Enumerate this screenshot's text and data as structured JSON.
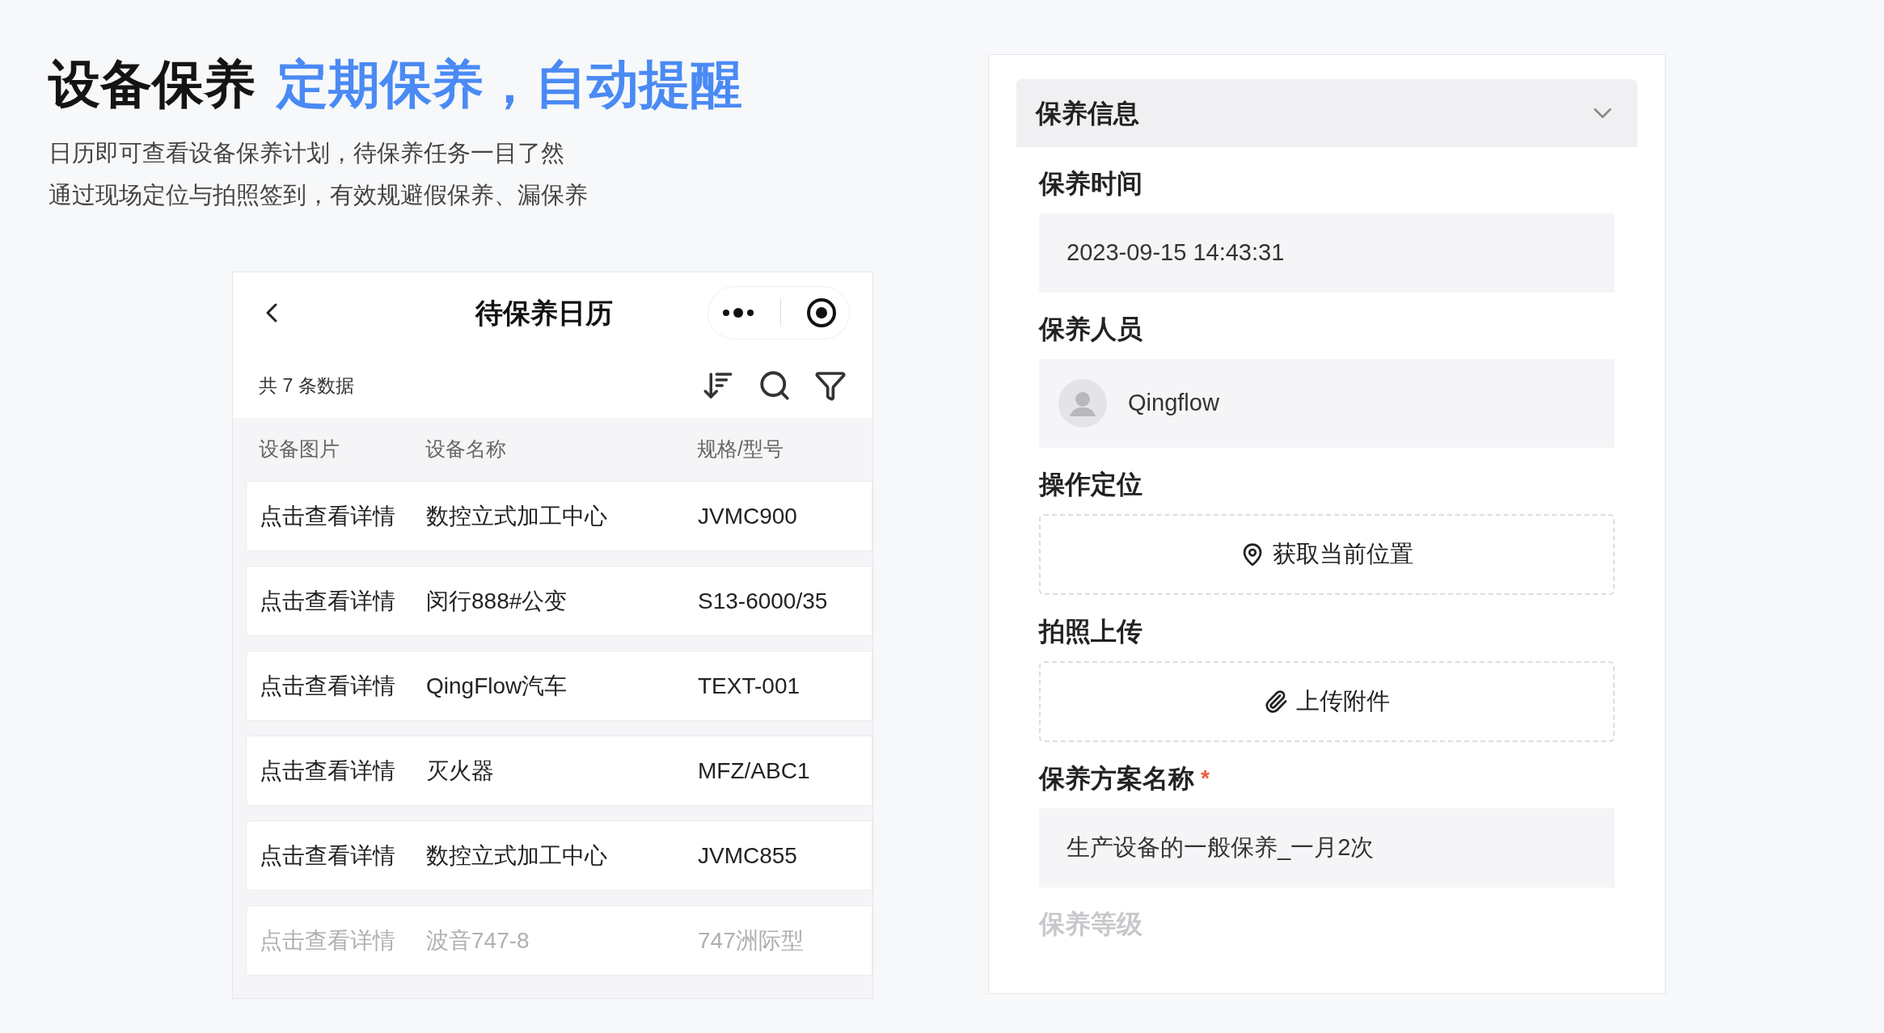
{
  "headline": {
    "main": "设备保养",
    "accent": "定期保养，自动提醒"
  },
  "description": [
    "日历即可查看设备保养计划，待保养任务一目了然",
    "通过现场定位与拍照签到，有效规避假保养、漏保养"
  ],
  "phone": {
    "title": "待保养日历",
    "count": "共 7 条数据",
    "columns": [
      "设备图片",
      "设备名称",
      "规格/型号"
    ],
    "rows": [
      {
        "cells": [
          "点击查看详情",
          "数控立式加工中心",
          "JVMC900"
        ]
      },
      {
        "cells": [
          "点击查看详情",
          "闵行888#公变",
          "S13-6000/35"
        ]
      },
      {
        "cells": [
          "点击查看详情",
          "QingFlow汽车",
          "TEXT-001"
        ]
      },
      {
        "cells": [
          "点击查看详情",
          "灭火器",
          "MFZ/ABC1"
        ]
      },
      {
        "cells": [
          "点击查看详情",
          "数控立式加工中心",
          "JVMC855"
        ]
      },
      {
        "cells": [
          "点击查看详情",
          "波音747-8",
          "747洲际型"
        ]
      }
    ]
  },
  "form": {
    "section": "保养信息",
    "expanded": true,
    "fields": [
      {
        "kind": "text",
        "label": "保养时间",
        "value": "2023-09-15 14:43:31"
      },
      {
        "kind": "user",
        "label": "保养人员",
        "value": "Qingflow"
      },
      {
        "kind": "location",
        "label": "操作定位",
        "value": "获取当前位置"
      },
      {
        "kind": "upload",
        "label": "拍照上传",
        "value": "上传附件"
      },
      {
        "kind": "text",
        "label": "保养方案名称",
        "value": "生产设备的一般保养_一月2次",
        "required_mark": "*"
      },
      {
        "kind": "label",
        "label": "保养等级"
      }
    ]
  }
}
